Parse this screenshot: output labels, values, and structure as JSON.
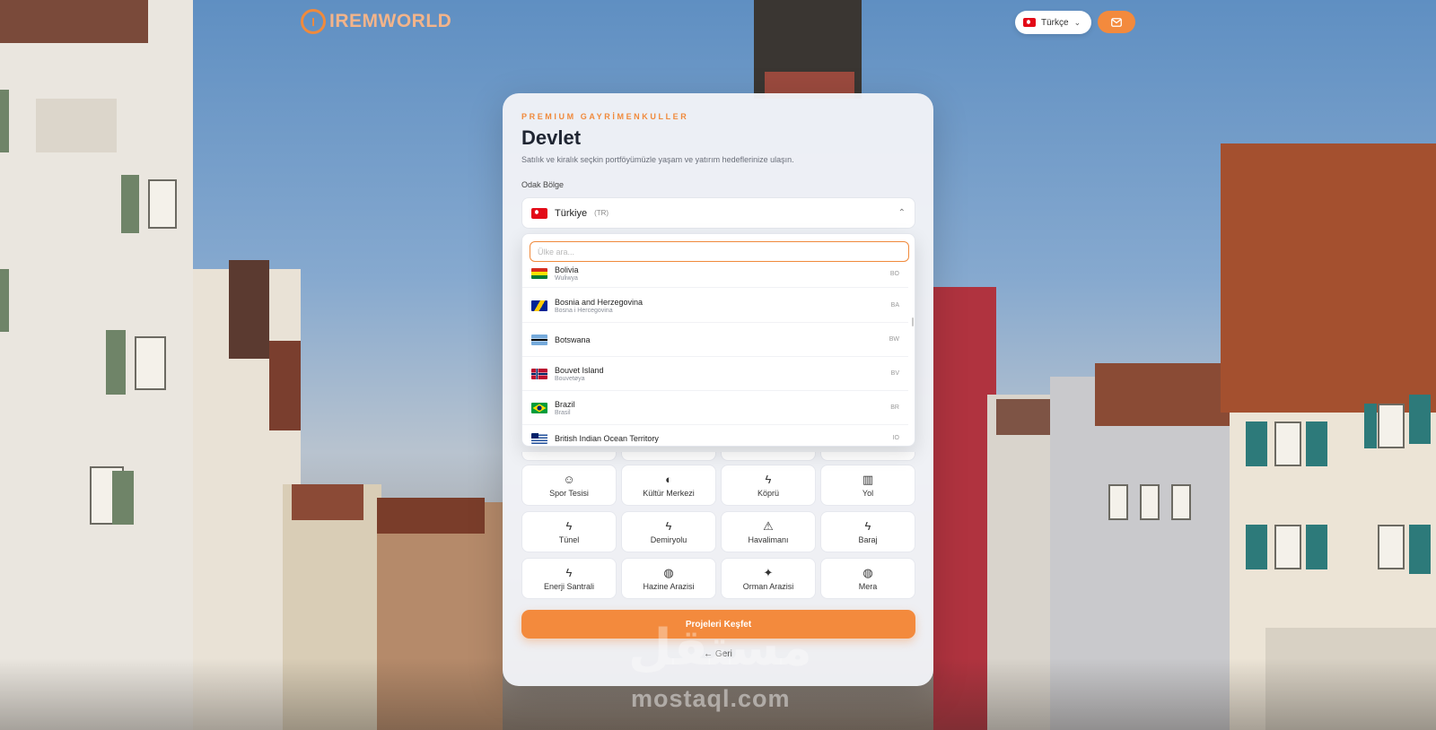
{
  "header": {
    "logo_mark": "I",
    "logo_text": "IREMWORLD",
    "language_label": "Türkçe"
  },
  "card": {
    "eyebrow": "PREMIUM GAYRİMENKULLER",
    "title": "Devlet",
    "subtitle": "Satılık ve kiralık seçkin portföyümüzle yaşam ve yatırım hedeflerinize ulaşın.",
    "field_label": "Odak Bölge",
    "selected": {
      "name": "Türkiye",
      "code": "(TR)"
    }
  },
  "dropdown": {
    "search_placeholder": "Ülke ara...",
    "options": [
      {
        "name": "Bolivia",
        "local": "Wuliwya",
        "code": "BO",
        "flag": "bolivia"
      },
      {
        "name": "Bosnia and Herzegovina",
        "local": "Bosna i Hercegovina",
        "code": "BA",
        "flag": "bosnia"
      },
      {
        "name": "Botswana",
        "local": "",
        "code": "BW",
        "flag": "botswana"
      },
      {
        "name": "Bouvet Island",
        "local": "Bouvetøya",
        "code": "BV",
        "flag": "norway"
      },
      {
        "name": "Brazil",
        "local": "Brasil",
        "code": "BR",
        "flag": "brazil"
      },
      {
        "name": "British Indian Ocean Territory",
        "local": "",
        "code": "IO",
        "flag": "biot"
      }
    ]
  },
  "categories": [
    {
      "label": "Spor Tesisi",
      "icon": "smile-icon"
    },
    {
      "label": "Kültür Merkezi",
      "icon": "palette-icon"
    },
    {
      "label": "Köprü",
      "icon": "bolt-icon"
    },
    {
      "label": "Yol",
      "icon": "map-icon"
    },
    {
      "label": "Tünel",
      "icon": "bolt-icon"
    },
    {
      "label": "Demiryolu",
      "icon": "bolt-icon"
    },
    {
      "label": "Havalimanı",
      "icon": "warning-icon"
    },
    {
      "label": "Baraj",
      "icon": "bolt-icon"
    },
    {
      "label": "Enerji Santrali",
      "icon": "bolt-icon"
    },
    {
      "label": "Hazine Arazisi",
      "icon": "globe-icon"
    },
    {
      "label": "Orman Arazisi",
      "icon": "sparkle-icon"
    },
    {
      "label": "Mera",
      "icon": "globe-icon"
    }
  ],
  "actions": {
    "cta": "Projeleri Keşfet",
    "back": "← Geri"
  },
  "watermark": {
    "arabic": "مستقل",
    "latin": "mostaql.com"
  },
  "colors": {
    "accent": "#f38a3d",
    "title": "#1f2532"
  }
}
